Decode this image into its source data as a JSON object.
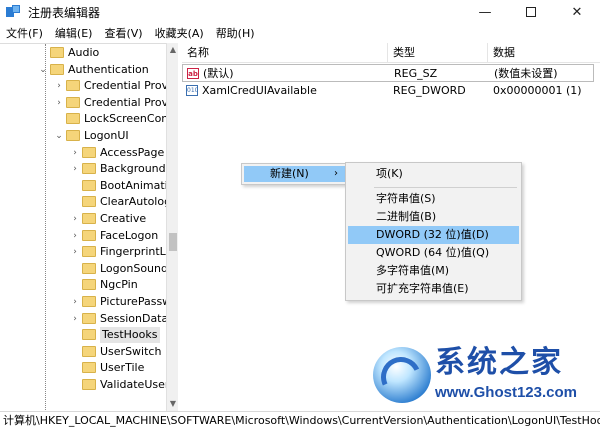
{
  "window": {
    "title": "注册表编辑器"
  },
  "menubar": [
    "文件(F)",
    "编辑(E)",
    "查看(V)",
    "收藏夹(A)",
    "帮助(H)"
  ],
  "window_buttons": {
    "minimize": "—",
    "maximize": "",
    "close": "✕"
  },
  "tree": {
    "items": [
      {
        "label": "Audio",
        "depth": 0,
        "arrow": ""
      },
      {
        "label": "Authentication",
        "depth": 0,
        "arrow": "⌄"
      },
      {
        "label": "Credential Provic",
        "depth": 1,
        "arrow": "›"
      },
      {
        "label": "Credential Provic",
        "depth": 1,
        "arrow": "›"
      },
      {
        "label": "LockScreenConte",
        "depth": 1,
        "arrow": ""
      },
      {
        "label": "LogonUI",
        "depth": 1,
        "arrow": "⌄"
      },
      {
        "label": "AccessPage",
        "depth": 2,
        "arrow": "›"
      },
      {
        "label": "Background",
        "depth": 2,
        "arrow": "›"
      },
      {
        "label": "BootAnimatio",
        "depth": 2,
        "arrow": ""
      },
      {
        "label": "ClearAutologo",
        "depth": 2,
        "arrow": ""
      },
      {
        "label": "Creative",
        "depth": 2,
        "arrow": "›"
      },
      {
        "label": "FaceLogon",
        "depth": 2,
        "arrow": "›"
      },
      {
        "label": "FingerprintLo",
        "depth": 2,
        "arrow": "›"
      },
      {
        "label": "LogonSoundP",
        "depth": 2,
        "arrow": ""
      },
      {
        "label": "NgcPin",
        "depth": 2,
        "arrow": ""
      },
      {
        "label": "PicturePasswo",
        "depth": 2,
        "arrow": "›"
      },
      {
        "label": "SessionData",
        "depth": 2,
        "arrow": "›"
      },
      {
        "label": "TestHooks",
        "depth": 2,
        "arrow": "",
        "selected": true
      },
      {
        "label": "UserSwitch",
        "depth": 2,
        "arrow": ""
      },
      {
        "label": "UserTile",
        "depth": 2,
        "arrow": ""
      },
      {
        "label": "ValidateUserr",
        "depth": 2,
        "arrow": ""
      }
    ]
  },
  "list": {
    "headers": {
      "name": "名称",
      "type": "类型",
      "data": "数据"
    },
    "rows": [
      {
        "icon": "ab",
        "name": "(默认)",
        "type": "REG_SZ",
        "data": "(数值未设置)"
      },
      {
        "icon": "010",
        "name": "XamlCredUIAvailable",
        "type": "REG_DWORD",
        "data": "0x00000001 (1)"
      }
    ]
  },
  "context_menu": {
    "label": "新建(N)",
    "arrow": "›"
  },
  "submenu": {
    "items": [
      {
        "label": "项(K)"
      },
      {
        "label": "字符串值(S)"
      },
      {
        "label": "二进制值(B)"
      },
      {
        "label": "DWORD (32 位)值(D)",
        "highlighted": true
      },
      {
        "label": "QWORD (64 位)值(Q)"
      },
      {
        "label": "多字符串值(M)"
      },
      {
        "label": "可扩充字符串值(E)"
      }
    ]
  },
  "watermark": {
    "title": "系统之家",
    "url": "www.Ghost123.com"
  },
  "status": {
    "path": "计算机\\HKEY_LOCAL_MACHINE\\SOFTWARE\\Microsoft\\Windows\\CurrentVersion\\Authentication\\LogonUI\\TestHooks"
  },
  "colors": {
    "selection": "#91c9f7",
    "folder": "#f5d57a",
    "watermark": "#1e4fa8"
  }
}
